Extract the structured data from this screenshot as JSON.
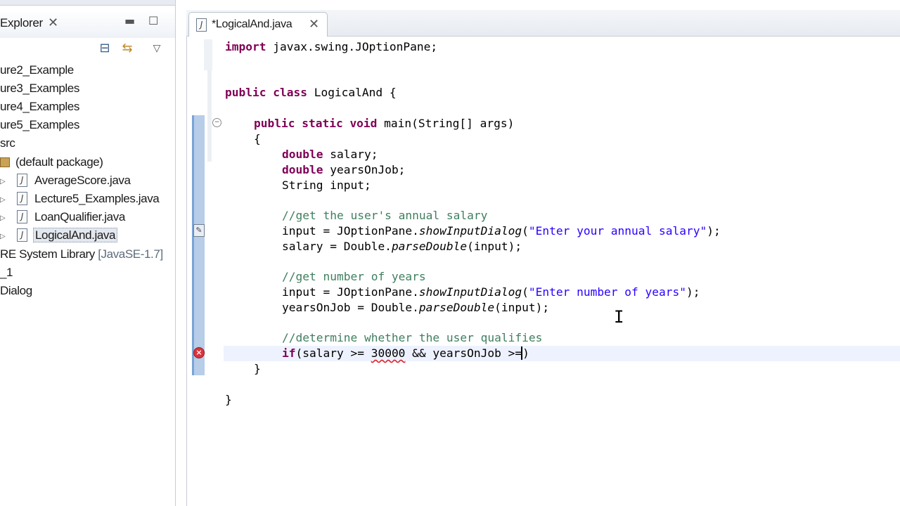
{
  "explorer": {
    "title": "Explorer",
    "items": [
      {
        "label": "ure2_Example"
      },
      {
        "label": "ure3_Examples"
      },
      {
        "label": "ure4_Examples"
      },
      {
        "label": "ure5_Examples"
      },
      {
        "label": "src"
      },
      {
        "label": "(default package)"
      },
      {
        "label": "AverageScore.java"
      },
      {
        "label": "Lecture5_Examples.java"
      },
      {
        "label": "LoanQualifier.java"
      },
      {
        "label": "LogicalAnd.java"
      },
      {
        "label": "RE System Library ",
        "extra": "[JavaSE-1.7]"
      },
      {
        "label": "_1"
      },
      {
        "label": "Dialog"
      }
    ]
  },
  "editor": {
    "tab_label": "*LogicalAnd.java",
    "code": {
      "l1_kw": "import",
      "l1_rest": " javax.swing.JOptionPane;",
      "l2_kw": "public class",
      "l2_rest": " LogicalAnd {",
      "l3_kw": "public static void",
      "l3_rest": " main(String[] args)",
      "l4": "{",
      "l5_kw": "double",
      "l5_rest": " salary;",
      "l6_kw": "double",
      "l6_rest": " yearsOnJob;",
      "l7": "String input;",
      "l8_comment": "//get the user's annual salary",
      "l9_a": "input = JOptionPane.",
      "l9_method": "showInputDialog",
      "l9_b": "(",
      "l9_str": "\"Enter your annual salary\"",
      "l9_c": ");",
      "l10_a": "salary = Double.",
      "l10_method": "parseDouble",
      "l10_b": "(input);",
      "l11_comment": "//get number of years",
      "l12_a": "input = JOptionPane.",
      "l12_method": "showInputDialog",
      "l12_b": "(",
      "l12_str": "\"Enter number of years\"",
      "l12_c": ");",
      "l13_a": "yearsOnJob = Double.",
      "l13_method": "parseDouble",
      "l13_b": "(input);",
      "l14_comment": "//determine whether the user qualifies",
      "l15_kw": "if",
      "l15_a": "(salary >= ",
      "l15_err": "30000",
      "l15_b": " && yearsOnJob >=",
      "l15_c": ")",
      "l16": "}",
      "l17": "}"
    }
  },
  "colors": {
    "keyword": "#7f0055",
    "comment": "#3f7f5f",
    "string": "#2a00ff",
    "error": "#d8363e"
  },
  "icons": {
    "explorer_close": "close-icon",
    "minimize": "minimize-icon",
    "maximize": "maximize-icon",
    "collapse_all": "collapse-all-icon",
    "link_editor": "link-with-editor-icon",
    "view_menu": "view-menu-icon",
    "error_marker": "error-icon"
  }
}
